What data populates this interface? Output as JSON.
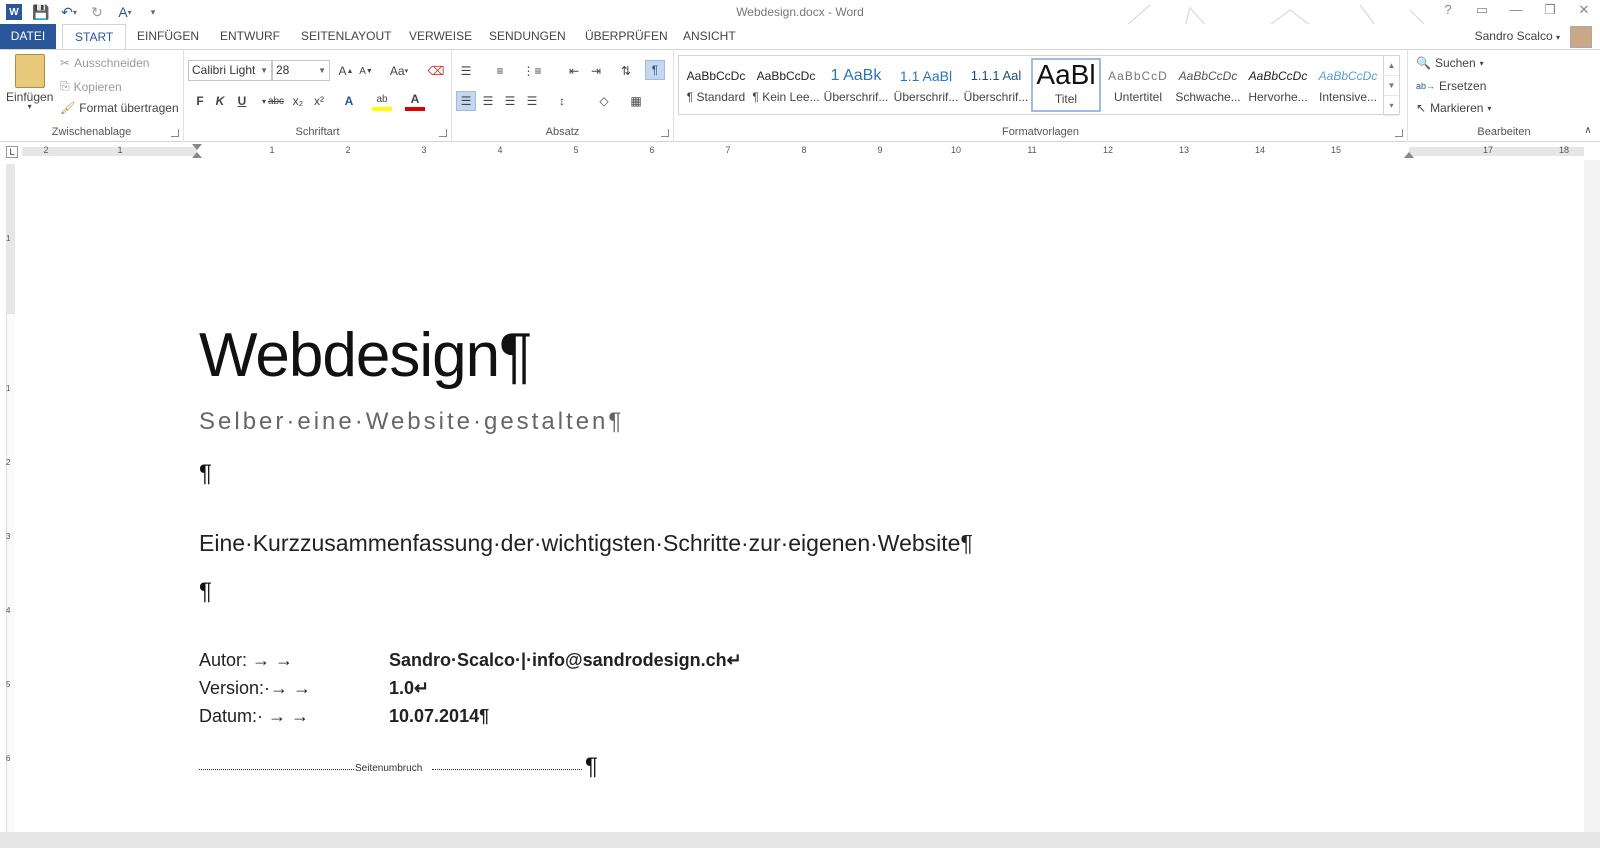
{
  "window": {
    "title": "Webdesign.docx - Word",
    "controls": {
      "help": "?",
      "ribbon_options": "▭",
      "minimize": "—",
      "restore": "❐",
      "close": "✕"
    }
  },
  "quick_access": {
    "icons": [
      "word-logo-icon",
      "save-icon",
      "undo-icon",
      "redo-icon",
      "format-icon",
      "customize-icon"
    ]
  },
  "tabs": [
    {
      "label": "DATEI"
    },
    {
      "label": "START"
    },
    {
      "label": "EINFÜGEN"
    },
    {
      "label": "ENTWURF"
    },
    {
      "label": "SEITENLAYOUT"
    },
    {
      "label": "VERWEISE"
    },
    {
      "label": "SENDUNGEN"
    },
    {
      "label": "ÜBERPRÜFEN"
    },
    {
      "label": "ANSICHT"
    }
  ],
  "user": {
    "name": "Sandro Scalco"
  },
  "ribbon": {
    "clipboard": {
      "label": "Zwischenablage",
      "paste": "Einfügen",
      "cut": "Ausschneiden",
      "copy": "Kopieren",
      "format_painter": "Format übertragen"
    },
    "font": {
      "label": "Schriftart",
      "family": "Calibri Light",
      "size": "28",
      "bold": "F",
      "italic": "K",
      "underline": "U",
      "strike": "abc",
      "subscript": "x₂",
      "superscript": "x²",
      "grow": "A",
      "shrink": "A",
      "case": "Aa",
      "text_effects": "A",
      "highlight": "ab",
      "font_color": "A"
    },
    "paragraph": {
      "label": "Absatz",
      "show_marks": "¶"
    },
    "styles": {
      "label": "Formatvorlagen",
      "items": [
        {
          "preview": "AaBbCcDc",
          "name": "¶ Standard"
        },
        {
          "preview": "AaBbCcDc",
          "name": "¶ Kein Lee..."
        },
        {
          "preview": "1  AaBk",
          "name": "Überschrif..."
        },
        {
          "preview": "1.1  AaBl",
          "name": "Überschrif..."
        },
        {
          "preview": "1.1.1  Aal",
          "name": "Überschrif..."
        },
        {
          "preview": "AaBl",
          "name": "Titel"
        },
        {
          "preview": "AaBbCcD",
          "name": "Untertitel"
        },
        {
          "preview": "AaBbCcDc",
          "name": "Schwache..."
        },
        {
          "preview": "AaBbCcDc",
          "name": "Hervorhe..."
        },
        {
          "preview": "AaBbCcDc",
          "name": "Intensive..."
        }
      ]
    },
    "editing": {
      "label": "Bearbeiten",
      "find": "Suchen",
      "replace": "Ersetzen",
      "select": "Markieren"
    }
  },
  "ruler": {
    "tab_selector": "L",
    "numbers": [
      "2",
      "1",
      "1",
      "2",
      "3",
      "4",
      "5",
      "6",
      "7",
      "8",
      "9",
      "10",
      "11",
      "12",
      "13",
      "14",
      "15",
      "17",
      "18"
    ],
    "vertical_numbers": [
      "1",
      "1",
      "2",
      "3",
      "4",
      "5",
      "6"
    ]
  },
  "document": {
    "title": "Webdesign¶",
    "subtitle": "Selber·eine·Website·gestalten¶",
    "empty_para_1": "¶",
    "summary": "Eine·Kurzzusammenfassung·der·wichtigsten·Schritte·zur·eigenen·Website¶",
    "empty_para_2": "¶",
    "meta": [
      {
        "label": "Autor:  →       →",
        "value": "Sandro·Scalco·|·info@sandrodesign.ch↵"
      },
      {
        "label": "Version:·→       →",
        "value": "1.0↵"
      },
      {
        "label": "Datum:· →       →",
        "value": "10.07.2014¶"
      }
    ],
    "page_break": "Seitenumbruch",
    "page_break_mark": "¶"
  },
  "colors": {
    "accent": "#2b579a",
    "selected_bg": "#c5d7ee",
    "ruler_grey": "#e6e6e6"
  }
}
